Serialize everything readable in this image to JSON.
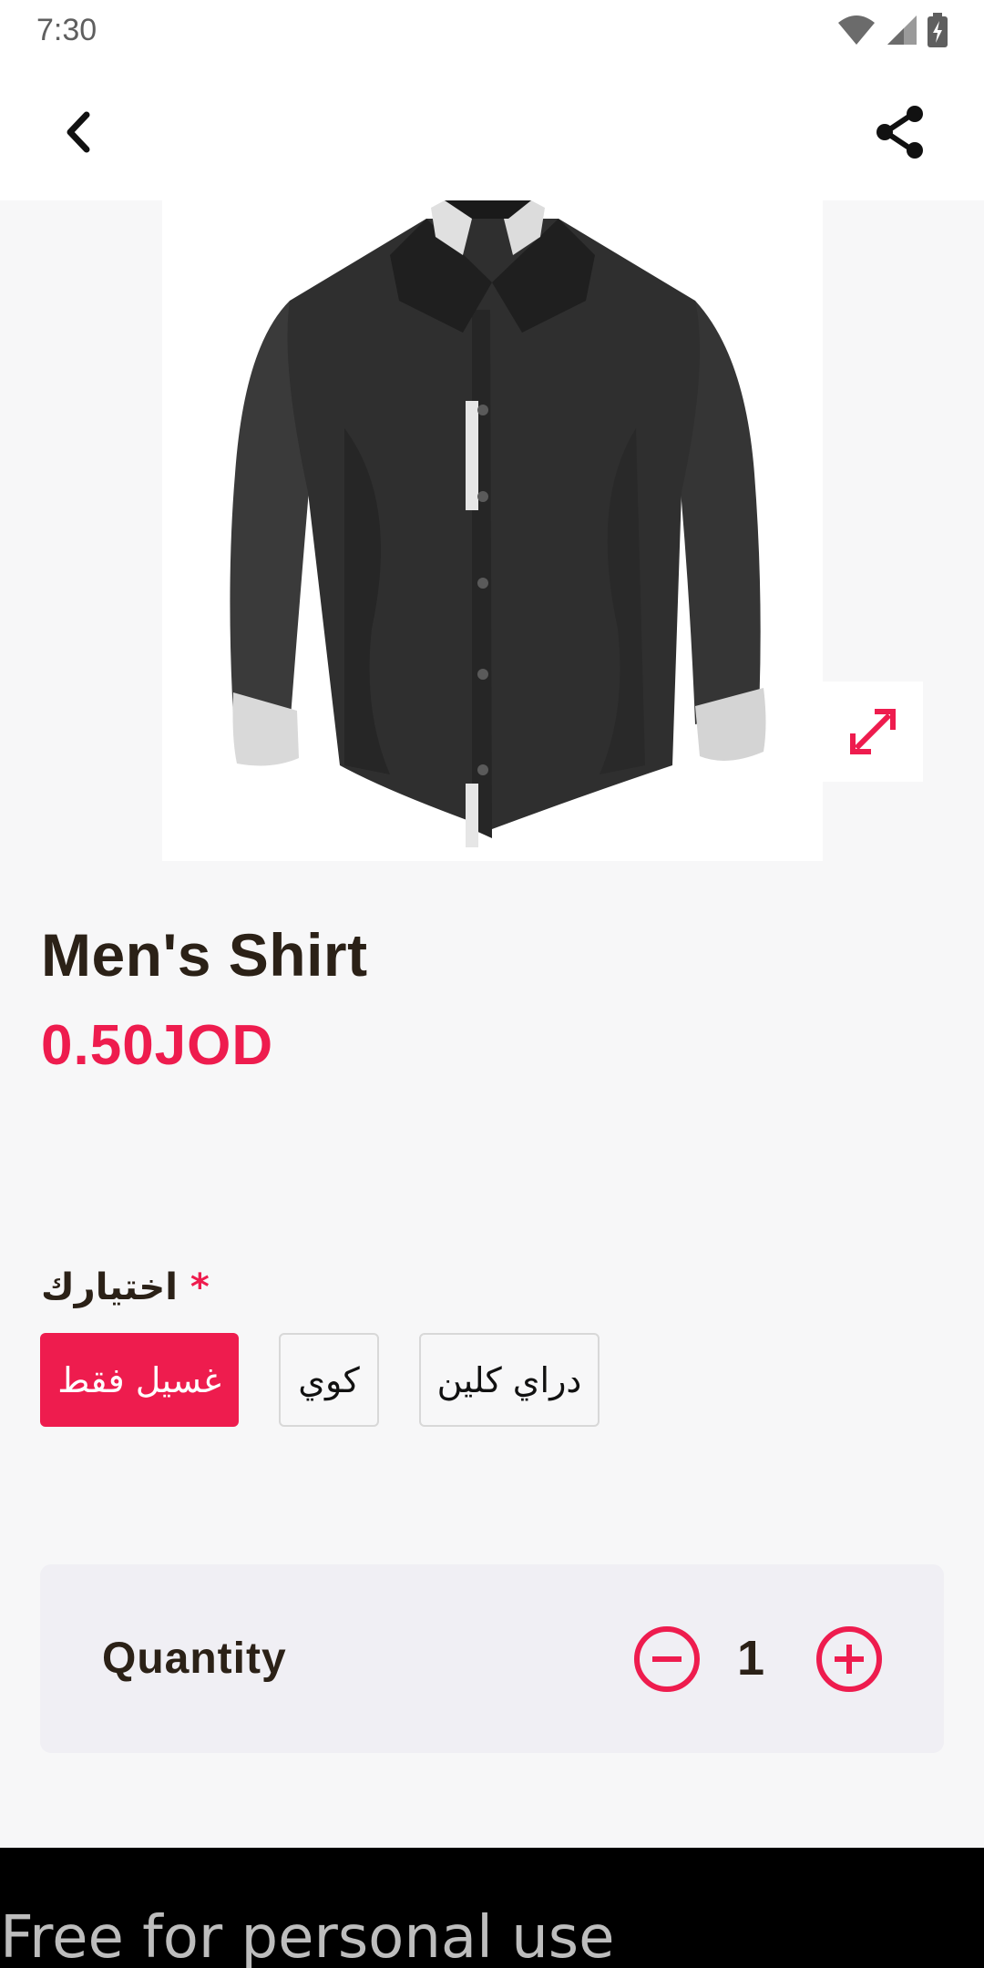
{
  "status_bar": {
    "time": "7:30",
    "icons": [
      "wifi-icon",
      "signal-icon",
      "battery-charging-icon"
    ]
  },
  "app_bar": {
    "back_icon": "chevron-left-icon",
    "share_icon": "share-icon"
  },
  "product": {
    "image": "black-dress-shirt-with-white-collar-and-cuffs",
    "expand_icon": "expand-arrows-icon",
    "name": "Men's Shirt",
    "price": "0.50JOD"
  },
  "options": {
    "label": "اختيارك",
    "required_mark": "*",
    "items": [
      {
        "label": "غسيل فقط",
        "selected": true
      },
      {
        "label": "كوي",
        "selected": false
      },
      {
        "label": "دراي كلين",
        "selected": false
      }
    ]
  },
  "quantity": {
    "label": "Quantity",
    "value": "1",
    "minus_icon": "minus-circle-icon",
    "plus_icon": "plus-circle-icon"
  },
  "footer": {
    "text": "Free for personal use"
  },
  "colors": {
    "accent": "#ee1c4e",
    "text_dark": "#2b2117",
    "background": "#f7f7f8",
    "quantity_card": "#f0eff4"
  }
}
